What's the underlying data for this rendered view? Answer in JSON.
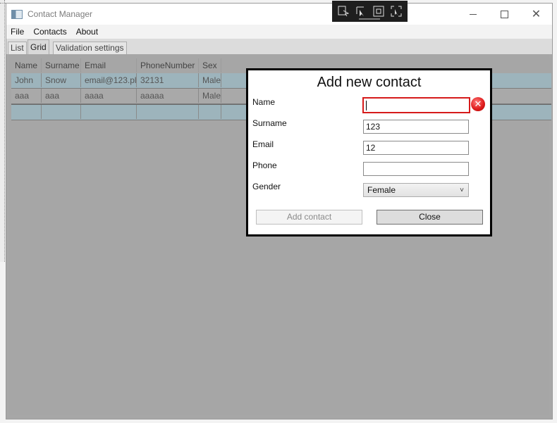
{
  "window": {
    "title": "Contact Manager",
    "controls": {
      "minimize_icon": "minimize-icon",
      "maximize_icon": "maximize-icon",
      "close_glyph": "✕"
    }
  },
  "devtools": {
    "icons": [
      "select-element-icon",
      "pointer-icon",
      "layout-adorner-icon",
      "track-focus-icon"
    ]
  },
  "menu": {
    "items": [
      "File",
      "Contacts",
      "About"
    ]
  },
  "tabs": [
    {
      "label": "List"
    },
    {
      "label": "Grid",
      "active": true
    },
    {
      "label": "Validation settings"
    }
  ],
  "grid": {
    "columns": [
      "Name",
      "Surname",
      "Email",
      "PhoneNumber",
      "Sex"
    ],
    "rows": [
      [
        "John",
        "Snow",
        "email@123.pl",
        "32131",
        "Male"
      ],
      [
        "aaa",
        "aaa",
        "aaaa",
        "aaaaa",
        "Male"
      ],
      [
        "",
        "",
        "",
        "",
        ""
      ]
    ],
    "row_color": "#9db4bc"
  },
  "dialog": {
    "title": "Add new contact",
    "fields": {
      "name": {
        "label": "Name",
        "value": ""
      },
      "surname": {
        "label": "Surname",
        "value": "123"
      },
      "email": {
        "label": "Email",
        "value": "12"
      },
      "phone": {
        "label": "Phone",
        "value": ""
      },
      "gender": {
        "label": "Gender",
        "value": "Female"
      }
    },
    "error_color": "#d61a1a",
    "buttons": {
      "add": "Add contact",
      "close": "Close"
    }
  }
}
